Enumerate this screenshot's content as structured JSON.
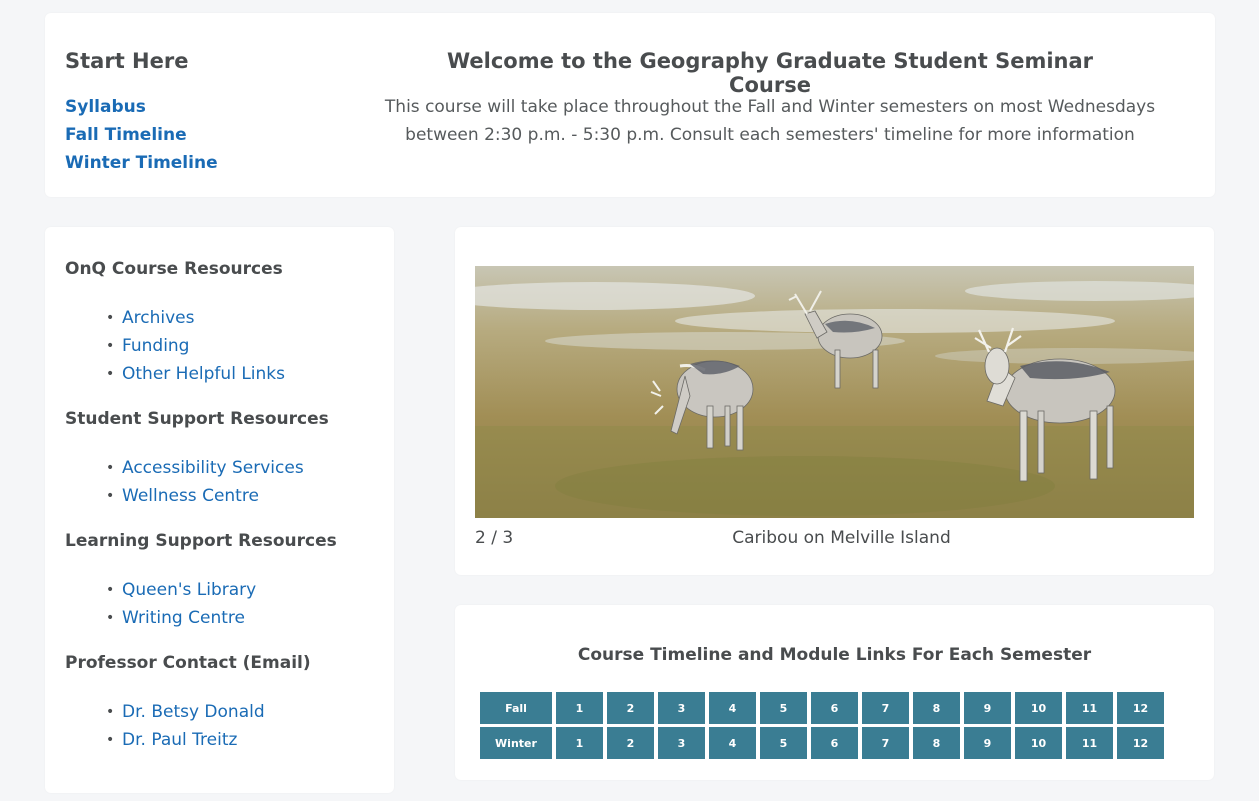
{
  "start": {
    "title": "Start Here",
    "links": [
      "Syllabus",
      "Fall Timeline",
      "Winter Timeline"
    ]
  },
  "welcome": {
    "title": "Welcome to the Geography Graduate Student Seminar Course",
    "line1": "This course will take place throughout the Fall and Winter semesters on most Wednesdays",
    "line2": "between 2:30 p.m. - 5:30 p.m. Consult each semesters' timeline for more information"
  },
  "resources": [
    {
      "heading": "OnQ Course Resources",
      "items": [
        "Archives",
        "Funding",
        "Other Helpful Links"
      ]
    },
    {
      "heading": "Student Support Resources",
      "items": [
        "Accessibility Services",
        "Wellness Centre"
      ]
    },
    {
      "heading": "Learning Support Resources",
      "items": [
        "Queen's Library",
        "Writing Centre"
      ]
    },
    {
      "heading": "Professor Contact (Email)",
      "items": [
        "Dr. Betsy Donald",
        "Dr. Paul Treitz"
      ]
    }
  ],
  "carousel": {
    "counter": "2 / 3",
    "caption": "Caribou on Melville Island",
    "image_subject": "caribou-photo"
  },
  "timeline": {
    "title": "Course Timeline and Module Links For Each Semester",
    "semesters": [
      {
        "label": "Fall",
        "modules": [
          "1",
          "2",
          "3",
          "4",
          "5",
          "6",
          "7",
          "8",
          "9",
          "10",
          "11",
          "12"
        ]
      },
      {
        "label": "Winter",
        "modules": [
          "1",
          "2",
          "3",
          "4",
          "5",
          "6",
          "7",
          "8",
          "9",
          "10",
          "11",
          "12"
        ]
      }
    ]
  },
  "colors": {
    "link": "#1a6bb5",
    "button": "#3a7d93",
    "background": "#f5f6f8"
  }
}
